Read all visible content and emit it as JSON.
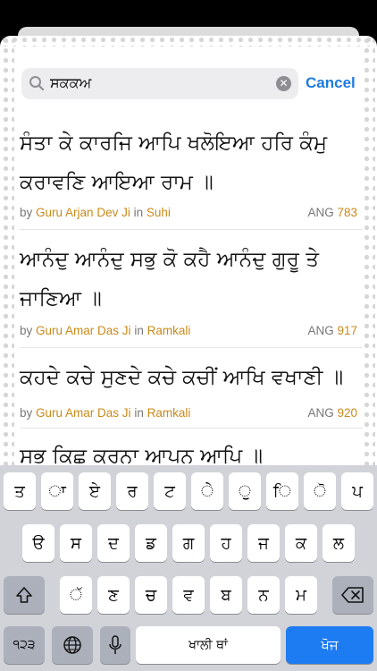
{
  "search": {
    "query": "ਸਕਕਅ",
    "cancel_label": "Cancel"
  },
  "results": [
    {
      "lines": [
        "ਸੰਤਾ ਕੇ ਕਾਰਜਿ ਆਪਿ ਖਲੋਇਆ ਹਰਿ ਕੰਮੁ",
        "ਕਰਾਵਣਿ ਆਇਆ ਰਾਮ ॥"
      ],
      "by": "by",
      "author": "Guru Arjan Dev Ji",
      "in": "in",
      "raag": "Suhi",
      "ang_label": "ANG",
      "ang": "783"
    },
    {
      "lines": [
        "ਆਨੰਦੁ ਆਨੰਦੁ ਸਭੁ ਕੋ ਕਹੈ ਆਨੰਦੁ ਗੁਰੂ ਤੇ",
        "ਜਾਣਿਆ ॥"
      ],
      "by": "by",
      "author": "Guru Amar Das Ji",
      "in": "in",
      "raag": "Ramkali",
      "ang_label": "ANG",
      "ang": "917"
    },
    {
      "lines": [
        "ਕਹਦੇ ਕਚੇ ਸੁਣਦੇ ਕਚੇ ਕਚੀਂ ਆਖਿ ਵਖਾਣੀ ॥"
      ],
      "by": "by",
      "author": "Guru Amar Das Ji",
      "in": "in",
      "raag": "Ramkali",
      "ang_label": "ANG",
      "ang": "920"
    },
    {
      "lines": [
        "ਸਭ ਕਿਛ ਕਰਨਾ ਆਪਨ ਆਪਿ ॥"
      ]
    }
  ],
  "keyboard": {
    "row1": [
      "ਤ",
      "ਾ",
      "ਏ",
      "ਰ",
      "ਟ",
      "ੇ",
      "ੁ",
      "ਿ",
      "ੋ",
      "ਪ"
    ],
    "row2": [
      "ੳ",
      "ਸ",
      "ਦ",
      "ਡ",
      "ਗ",
      "ਹ",
      "ਜ",
      "ਕ",
      "ਲ"
    ],
    "row3": [
      "ੱ",
      "ਣ",
      "ਚ",
      "ਵ",
      "ਬ",
      "ਨ",
      "ਮ"
    ],
    "numbers_label": "੧੨੩",
    "space_label": "ਖਾਲੀ ਥਾਂ",
    "search_label": "ਖੋਜ",
    "icons": {
      "shift": "shift-icon",
      "backspace": "backspace-icon",
      "globe": "globe-icon",
      "mic": "microphone-icon"
    }
  },
  "colors": {
    "accent": "#1f7ae0",
    "gold": "#c98a1a",
    "keyboard_bg": "#d1d3d9",
    "search_key": "#1e7cf2"
  }
}
